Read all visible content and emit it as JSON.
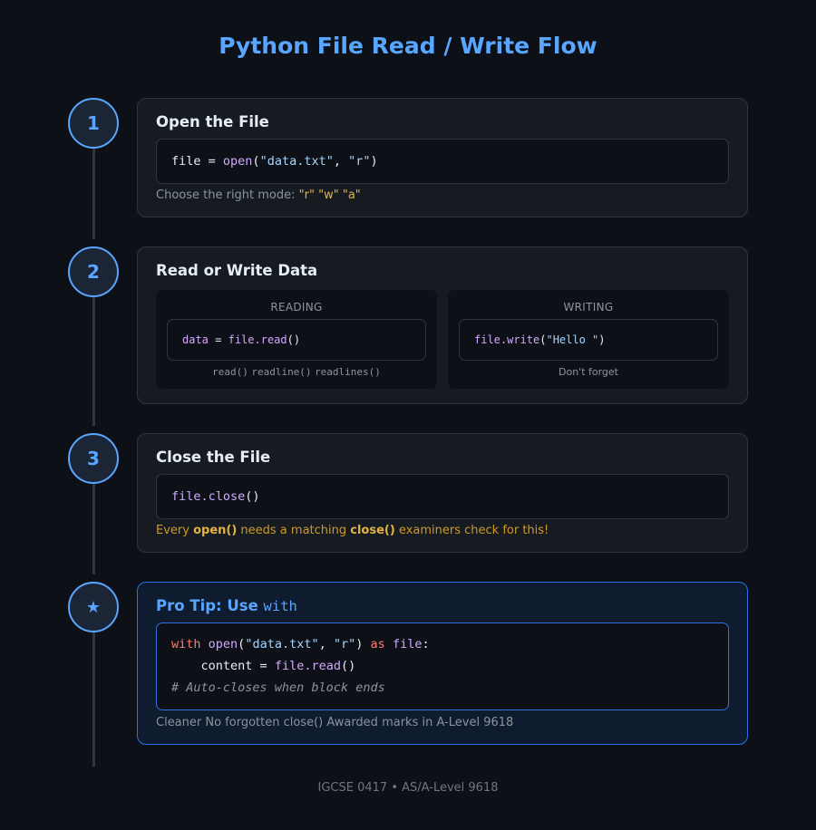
{
  "title": "Python File Read / Write Flow",
  "steps": [
    {
      "badge": "1",
      "title": "Open the File",
      "code": {
        "var": "file",
        "eq": " = ",
        "fn": "open",
        "p1": "(",
        "arg1": "\"data.txt\"",
        "comma": ", ",
        "arg2": "\"r\"",
        "p2": ")"
      },
      "note_prefix": "Choose the right mode:",
      "modes": [
        "\"r\"",
        "\"w\"",
        "\"a\""
      ]
    },
    {
      "badge": "2",
      "title": "Read or Write Data",
      "reading": {
        "label": "READING",
        "code": {
          "var": "data",
          "eq": " = ",
          "fn": "file.read",
          "paren": "()"
        },
        "methods": [
          "read()",
          "readline()",
          "readlines()"
        ]
      },
      "writing": {
        "label": "WRITING",
        "code": {
          "fn": "file.write",
          "p1": "(",
          "arg": "\"Hello \"",
          "p2": ")"
        },
        "note": "Don't forget"
      }
    },
    {
      "badge": "3",
      "title": "Close the File",
      "code": {
        "fn": "file.close",
        "paren": "()"
      },
      "note": {
        "t1": "Every ",
        "b1": "open()",
        "t2": " needs a matching ",
        "b2": "close()",
        "t3": " examiners check for this!"
      }
    },
    {
      "badge": "★",
      "title_text": "Pro Tip: Use",
      "title_code": "with",
      "code_lines": {
        "l1": {
          "kw": "with",
          "fn": "open",
          "p1": "(",
          "arg1": "\"data.txt\"",
          "comma": ", ",
          "arg2": "\"r\"",
          "p2": ")",
          "as": "as",
          "var": "file",
          "colon": ":"
        },
        "l2": {
          "indent": "    ",
          "var": "content",
          "eq": " = ",
          "fn": "file.read",
          "paren": "()"
        },
        "l3": "# Auto-closes when block ends"
      },
      "note": "Cleaner No forgotten close() Awarded marks in A-Level 9618"
    }
  ],
  "footer": "IGCSE 0417 • AS/A-Level 9618",
  "colors": {
    "accent": "#58a6ff",
    "keyword": "#ff7b72",
    "function": "#d2a8ff",
    "string": "#a5d6ff",
    "warning": "#d29922"
  }
}
